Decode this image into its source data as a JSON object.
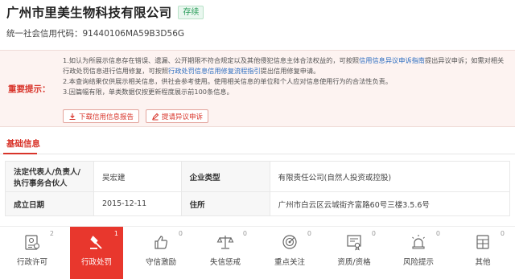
{
  "header": {
    "company_name": "广州市里美生物科技有限公司",
    "status_badge": "存续",
    "credit_code_label": "统一社会信用代码：",
    "credit_code": "91440106MA59B3D56G"
  },
  "notice": {
    "label": "重要提示：",
    "p1_a": "1.如认为所展示信息存在错误、遗漏、公开期限不符合规定以及其他侵犯信息主体合法权益的，可按照",
    "p1_link1": "信用信息异议申诉指南",
    "p1_b": "提出异议申诉；如需对相关行政处罚信息进行信用修复，可按照",
    "p1_link2": "行政处罚信息信用修复流程指引",
    "p1_c": "提出信用修复申请。",
    "p2": "2.本查询结果仅供展示相关信息，供社会参考使用。使用相关信息的单位和个人应对信息使用行为的合法性负责。",
    "p3": "3.因篇幅有限，单类数据仅按更新程度展示前100条信息。",
    "btn_download": "下载信用信息报告",
    "btn_objection": "提请异议申诉"
  },
  "section": {
    "title": "基础信息"
  },
  "info": {
    "legal_rep_label": "法定代表人/负责人/执行事务合伙人",
    "legal_rep": "吴宏建",
    "type_label": "企业类型",
    "type": "有限责任公司(自然人投资或控股)",
    "date_label": "成立日期",
    "date": "2015-12-11",
    "address_label": "住所",
    "address": "广州市白云区云城街齐富路60号三楼3.5.6号"
  },
  "tabs": [
    {
      "label": "行政许可",
      "count": "2",
      "icon": "license-icon"
    },
    {
      "label": "行政处罚",
      "count": "1",
      "icon": "gavel-icon"
    },
    {
      "label": "守信激励",
      "count": "0",
      "icon": "thumbs-up-icon"
    },
    {
      "label": "失信惩戒",
      "count": "0",
      "icon": "scale-icon"
    },
    {
      "label": "重点关注",
      "count": "0",
      "icon": "target-icon"
    },
    {
      "label": "资质/资格",
      "count": "0",
      "icon": "certificate-icon"
    },
    {
      "label": "风险提示",
      "count": "0",
      "icon": "alarm-icon"
    },
    {
      "label": "其他",
      "count": "0",
      "icon": "grid-icon"
    }
  ],
  "colors": {
    "accent": "#e8372d",
    "link": "#2f6fc1",
    "status_green": "#2a9d5a"
  }
}
